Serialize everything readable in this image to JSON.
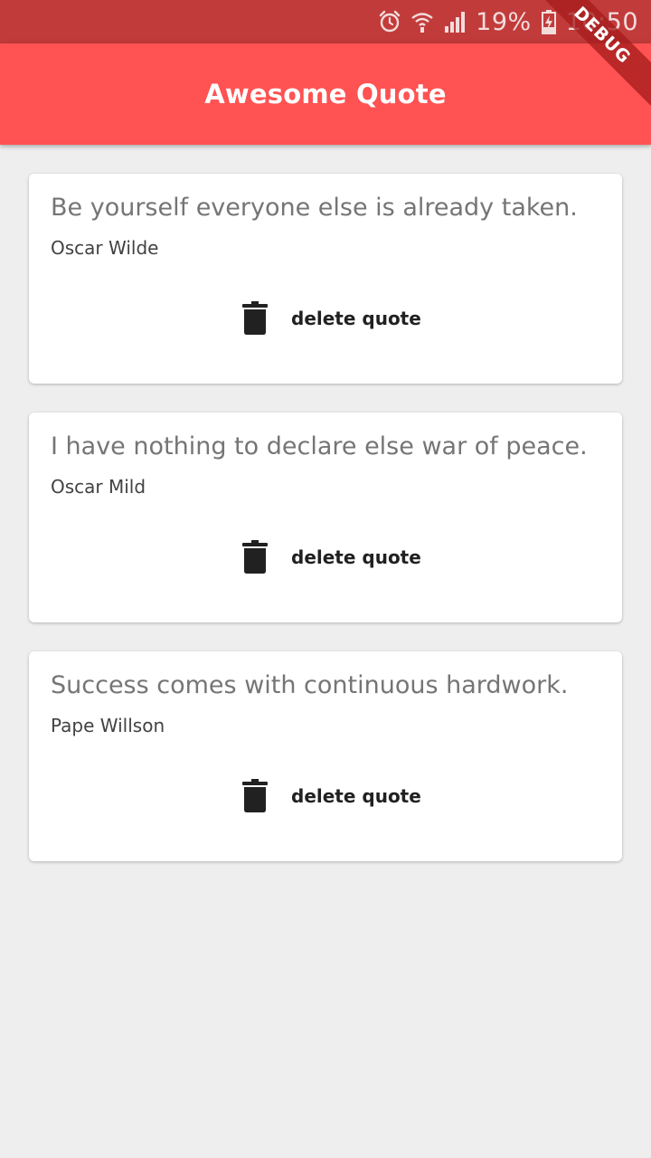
{
  "status_bar": {
    "battery": "19%",
    "time": "10:50"
  },
  "app_bar": {
    "title": "Awesome Quote"
  },
  "debug_banner": "DEBUG",
  "quotes": [
    {
      "text": "Be yourself everyone else is already taken.",
      "author": "Oscar Wilde",
      "action_label": "delete quote"
    },
    {
      "text": "I have nothing to declare else war of peace.",
      "author": "Oscar Mild",
      "action_label": "delete quote"
    },
    {
      "text": "Success comes with continuous hardwork.",
      "author": "Pape Willson",
      "action_label": "delete quote"
    }
  ],
  "colors": {
    "status_bar": "#c23b3b",
    "app_bar": "#ff5252",
    "background": "#eeeeee",
    "card": "#ffffff"
  }
}
